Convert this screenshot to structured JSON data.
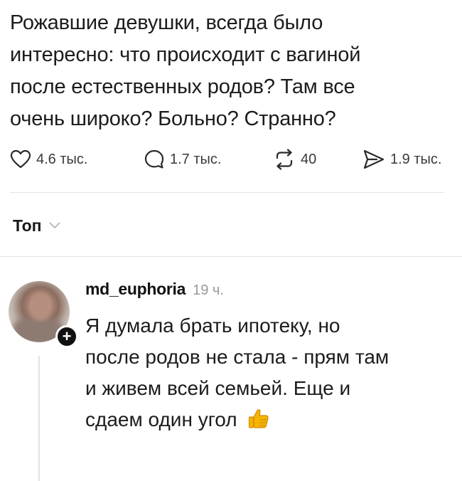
{
  "post": {
    "lines": [
      "Рожавшие девушки, всегда было",
      "интересно: что происходит с вагиной",
      "после естественных родов? Там все",
      "очень широко? Больно? Странно?"
    ]
  },
  "actions": {
    "likes": "4.6 тыс.",
    "replies": "1.7 тыс.",
    "reposts": "40",
    "shares": "1.9 тыс."
  },
  "sort": {
    "label": "Топ"
  },
  "comment": {
    "username": "md_euphoria",
    "time": "19 ч.",
    "lines": [
      "Я думала брать ипотеку, но",
      "после родов не стала - прям там",
      "и живем всей семьей. Еще и",
      "сдаем один угол"
    ]
  },
  "icons": {
    "like": "heart-icon",
    "reply": "speech-bubble-icon",
    "repost": "repost-icon",
    "share": "send-icon",
    "thumbs_up": "thumbs-up-emoji",
    "follow": "plus-icon"
  },
  "colors": {
    "text": "#1c1c1c",
    "muted": "#9a9a9a",
    "divider": "#e6e6e6",
    "thumb": "#f5b400"
  }
}
